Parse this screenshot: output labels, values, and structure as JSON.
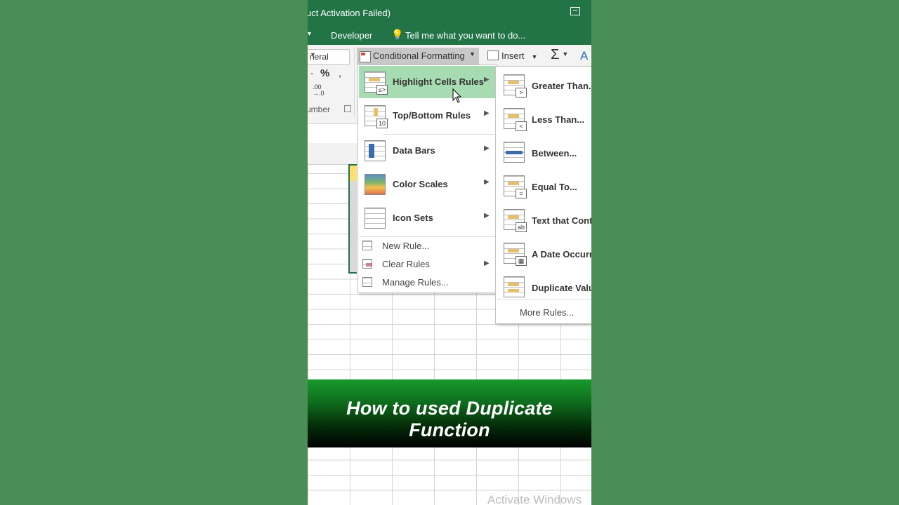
{
  "window": {
    "title": "uct Activation Failed)"
  },
  "menubar": {
    "developer": "Developer",
    "tell_me": "Tell me what you want to do..."
  },
  "ribbon": {
    "number_format": "neral",
    "percent": "%",
    "comma": ",",
    "dash": "-",
    "decimals": ".00\n→.0",
    "number_group": "umber",
    "conditional_formatting": "Conditional Formatting",
    "insert": "Insert",
    "sum": "Σ",
    "sort_glyph": "A"
  },
  "cf_menu": {
    "items": [
      {
        "label": "Highlight Cells Rules",
        "badge": "≤>",
        "highlighted": true
      },
      {
        "label": "Top/Bottom Rules",
        "badge": "10"
      },
      {
        "label": "Data Bars"
      },
      {
        "label": "Color Scales"
      },
      {
        "label": "Icon Sets"
      }
    ],
    "small_items": [
      {
        "label": "New Rule..."
      },
      {
        "label": "Clear Rules"
      },
      {
        "label": "Manage Rules..."
      }
    ]
  },
  "highlight_submenu": {
    "items": [
      {
        "label": "Greater Than...",
        "badge": ">"
      },
      {
        "label": "Less Than...",
        "badge": "<"
      },
      {
        "label": "Between...",
        "badge": ""
      },
      {
        "label": "Equal To...",
        "badge": "="
      },
      {
        "label": "Text that Contains...",
        "badge": "ab"
      },
      {
        "label": "A Date Occurring...",
        "badge": "▦"
      },
      {
        "label": "Duplicate Values...",
        "badge": ""
      }
    ],
    "more": "More Rules..."
  },
  "banner": {
    "text": "How to used Duplicate Function"
  },
  "watermark": "Activate Windows",
  "colors": {
    "excel_green": "#217346",
    "highlight": "#a7dbb2",
    "background": "#4a8e57"
  }
}
